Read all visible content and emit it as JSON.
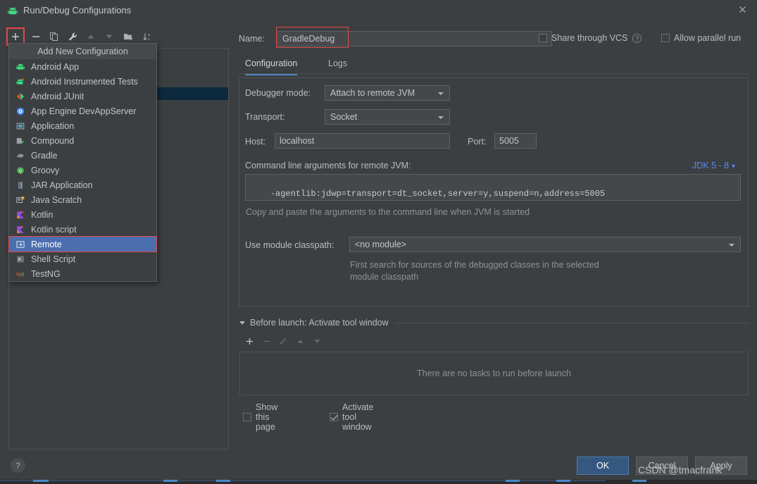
{
  "window": {
    "title": "Run/Debug Configurations",
    "app_icon": "android-icon",
    "close_icon": "close-icon"
  },
  "left_toolbar": {
    "buttons": [
      {
        "name": "add-configuration-button",
        "glyph": "+",
        "highlighted": true,
        "enabled": true
      },
      {
        "name": "remove-configuration-button",
        "glyph": "−",
        "enabled": true
      },
      {
        "name": "copy-configuration-button",
        "glyph": "copy-icon",
        "enabled": true
      },
      {
        "name": "edit-templates-button",
        "glyph": "wrench-icon",
        "enabled": true
      },
      {
        "name": "move-up-button",
        "glyph": "triangle-up-icon",
        "enabled": false
      },
      {
        "name": "move-down-button",
        "glyph": "triangle-down-icon",
        "enabled": false
      },
      {
        "name": "new-folder-button",
        "glyph": "folder-add-icon",
        "enabled": true
      },
      {
        "name": "sort-configurations-button",
        "glyph": "sort-az-icon",
        "enabled": true
      }
    ]
  },
  "popup_menu": {
    "header": "Add New Configuration",
    "items": [
      {
        "label": "Android App",
        "icon": "android-icon",
        "selected": false
      },
      {
        "label": "Android Instrumented Tests",
        "icon": "android-test-icon",
        "selected": false
      },
      {
        "label": "Android JUnit",
        "icon": "junit-icon",
        "selected": false
      },
      {
        "label": "App Engine DevAppServer",
        "icon": "app-engine-icon",
        "selected": false
      },
      {
        "label": "Application",
        "icon": "application-icon",
        "selected": false
      },
      {
        "label": "Compound",
        "icon": "compound-icon",
        "selected": false
      },
      {
        "label": "Gradle",
        "icon": "gradle-icon",
        "selected": false
      },
      {
        "label": "Groovy",
        "icon": "groovy-icon",
        "selected": false
      },
      {
        "label": "JAR Application",
        "icon": "jar-icon",
        "selected": false
      },
      {
        "label": "Java Scratch",
        "icon": "java-scratch-icon",
        "selected": false
      },
      {
        "label": "Kotlin",
        "icon": "kotlin-icon",
        "selected": false
      },
      {
        "label": "Kotlin script",
        "icon": "kotlin-icon",
        "selected": false
      },
      {
        "label": "Remote",
        "icon": "remote-icon",
        "selected": true
      },
      {
        "label": "Shell Script",
        "icon": "shell-icon",
        "selected": false
      },
      {
        "label": "TestNG",
        "icon": "testng-icon",
        "selected": false
      }
    ]
  },
  "header": {
    "name_label": "Name:",
    "name_value": "GradleDebug",
    "name_placeholder": "",
    "share_vcs_label": "Share through VCS",
    "share_vcs_checked": false,
    "share_vcs_help_icon": "question-icon",
    "allow_parallel_label": "Allow parallel run",
    "allow_parallel_checked": false
  },
  "tabs": [
    {
      "label": "Configuration",
      "active": true
    },
    {
      "label": "Logs",
      "active": false
    }
  ],
  "configuration": {
    "debugger_mode_label": "Debugger mode:",
    "debugger_mode_value": "Attach to remote JVM",
    "transport_label": "Transport:",
    "transport_value": "Socket",
    "host_label": "Host:",
    "host_value": "localhost",
    "port_label": "Port:",
    "port_value": "5005",
    "args_label": "Command line arguments for remote JVM:",
    "jdk_link": "JDK 5 - 8",
    "args_value": "-agentlib:jdwp=transport=dt_socket,server=y,suspend=n,address=5005",
    "args_hint": "Copy and paste the arguments to the command line when JVM is started",
    "module_classpath_label": "Use module classpath:",
    "module_classpath_value": "<no module>",
    "module_hint_line1": "First search for sources of the debugged classes in the selected",
    "module_hint_line2": "module classpath"
  },
  "before_launch": {
    "title": "Before launch: Activate tool window",
    "buttons": [
      {
        "name": "add-task-button",
        "glyph": "+",
        "enabled": true
      },
      {
        "name": "remove-task-button",
        "glyph": "−",
        "enabled": false
      },
      {
        "name": "edit-task-button",
        "glyph": "pencil-icon",
        "enabled": false
      },
      {
        "name": "task-move-up-button",
        "glyph": "triangle-up-icon",
        "enabled": false
      },
      {
        "name": "task-move-down-button",
        "glyph": "triangle-down-icon",
        "enabled": false
      }
    ],
    "empty_text": "There are no tasks to run before launch",
    "show_page_label": "Show this page",
    "show_page_checked": false,
    "activate_tool_window_label": "Activate tool window",
    "activate_tool_window_checked": true
  },
  "footer": {
    "help_label": "?",
    "ok_label": "OK",
    "cancel_label": "Cancel",
    "apply_label": "Apply"
  },
  "watermark": "CSDN @tmacfrank",
  "colors": {
    "background": "#3c3f41",
    "accent_blue": "#4b6eaf",
    "link_blue": "#548af7",
    "primary_button": "#365880",
    "highlight_red": "#e24a4a",
    "selected_row": "#0d293e"
  }
}
